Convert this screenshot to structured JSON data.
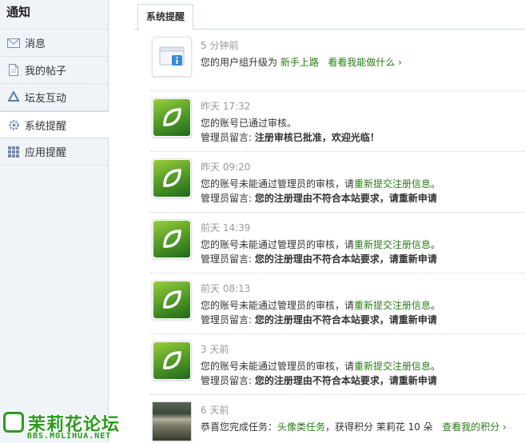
{
  "sidebar": {
    "title": "通知",
    "items": [
      {
        "label": "消息",
        "icon": "envelope-icon"
      },
      {
        "label": "我的帖子",
        "icon": "document-icon"
      },
      {
        "label": "坛友互动",
        "icon": "recycle-icon"
      },
      {
        "label": "系统提醒",
        "icon": "gear-icon",
        "active": true
      },
      {
        "label": "应用提醒",
        "icon": "grid-icon"
      }
    ]
  },
  "tabs": [
    {
      "label": "系统提醒"
    }
  ],
  "notices": [
    {
      "time": "5 分钟前",
      "icon": "info-window-icon",
      "line1_prefix": "您的用户组升级为",
      "line1_link1": "新手上路",
      "line1_link2": "看看我能做什么 ›"
    },
    {
      "time": "昨天 17:32",
      "icon": "leaf-logo",
      "line1": "您的账号已通过审核。",
      "line2_prefix": "管理员留言: ",
      "line2_bold": "注册审核已批准，欢迎光临！"
    },
    {
      "time": "昨天 09:20",
      "icon": "leaf-logo",
      "line1_prefix": "您的账号未能通过管理员的审核，请",
      "line1_link": "重新提交注册信息",
      "line1_suffix": "。",
      "line2_prefix": "管理员留言: ",
      "line2_bold": "您的注册理由不符合本站要求，请重新申请"
    },
    {
      "time": "前天 14:39",
      "icon": "leaf-logo",
      "line1_prefix": "您的账号未能通过管理员的审核，请",
      "line1_link": "重新提交注册信息",
      "line1_suffix": "。",
      "line2_prefix": "管理员留言: ",
      "line2_bold": "您的注册理由不符合本站要求，请重新申请"
    },
    {
      "time": "前天 08:13",
      "icon": "leaf-logo",
      "line1_prefix": "您的账号未能通过管理员的审核，请",
      "line1_link": "重新提交注册信息",
      "line1_suffix": "。",
      "line2_prefix": "管理员留言: ",
      "line2_bold": "您的注册理由不符合本站要求，请重新申请"
    },
    {
      "time": "3 天前",
      "icon": "leaf-logo",
      "line1_prefix": "您的账号未能通过管理员的审核，请",
      "line1_link": "重新提交注册信息",
      "line1_suffix": "。",
      "line2_prefix": "管理员留言: ",
      "line2_bold": "您的注册理由不符合本站要求，请重新申请"
    },
    {
      "time": "6 天前",
      "icon": "task-photo",
      "line1_prefix": "恭喜您完成任务：",
      "line1_link1": "头像类任务",
      "line1_mid": "，获得积分 茉莉花 10 朵",
      "line1_link2": "查看我的积分 ›"
    }
  ],
  "watermark": {
    "title": "茉莉花论坛",
    "url": "BBS.MOLIHUA.NET"
  },
  "colors": {
    "link": "#2a7a18",
    "sidebar_bg": "#f0f4f9",
    "border": "#cdd9e6"
  }
}
